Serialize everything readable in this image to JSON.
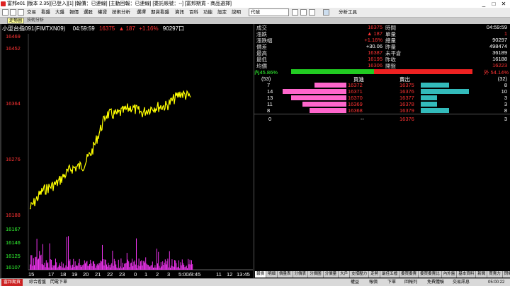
{
  "window": {
    "title": "富邦e01 [版本 2.35][已登入][1] [報價：已連線] [主動回報：已連線] [委託帳號：--] [富邦期貨 - 商品選擇]",
    "min": "_",
    "max": "□",
    "close": "✕"
  },
  "menu": {
    "items": [
      "交易",
      "看盤",
      "大盤",
      "報價",
      "選股",
      "權證",
      "技術分析",
      "選擇",
      "期貨看盤",
      "資訊",
      "百科",
      "功能",
      "設定",
      "說明",
      "視窗"
    ],
    "combo": "代號",
    "analysis": "分析工具"
  },
  "tabs": {
    "active": "走勢圖",
    "inactive": "技術分析"
  },
  "chart": {
    "product": "小型台指091(FIMTXN09)",
    "time": "04:59:59",
    "price": "16375",
    "arrow": "▲",
    "change": "187",
    "pct": "+1.16%",
    "volume": "90297口"
  },
  "chart_data": {
    "type": "line",
    "y_labels": [
      "16469",
      "16452",
      "16364",
      "16276",
      "16188"
    ],
    "vol_labels": [
      "16167",
      "16146",
      "16125",
      "16107"
    ],
    "x_labels": [
      "15",
      "17",
      "18",
      "19",
      "20",
      "21",
      "22",
      "23",
      "0",
      "1",
      "2",
      "3",
      "5:00/8:45",
      "11",
      "12",
      "13:45"
    ],
    "ylim": [
      16188,
      16469
    ]
  },
  "quote": {
    "left_labels": [
      "成交",
      "漲跌",
      "漲跌幅",
      "價差",
      "最高",
      "最低",
      "均價"
    ],
    "left_values": [
      "16375",
      "▲ 187",
      "+1.16%",
      "+30.06",
      "16387",
      "16195",
      "16306"
    ],
    "right_labels": [
      "時間",
      "單量",
      "總量",
      "昨量",
      "未平倉",
      "昨收",
      "開盤"
    ],
    "right_values": [
      "04:59:59",
      "1",
      "90297",
      "498474",
      "36189",
      "16188",
      "16223"
    ],
    "inner": "內45.86%",
    "outer": "外 54.14%",
    "bid_count": "(53)",
    "ask_count": "(32)",
    "bid_title": "買進",
    "ask_title": "賣出",
    "bids": [
      {
        "qty": "7",
        "price": "16372"
      },
      {
        "qty": "14",
        "price": "16371"
      },
      {
        "qty": "13",
        "price": "16370"
      },
      {
        "qty": "11",
        "price": "16369"
      },
      {
        "qty": "8",
        "price": "16368"
      }
    ],
    "asks": [
      {
        "price": "16375",
        "qty": "8"
      },
      {
        "price": "16376",
        "qty": "10"
      },
      {
        "price": "16377",
        "qty": "3"
      },
      {
        "price": "16378",
        "qty": "3"
      },
      {
        "price": "16379",
        "qty": "8"
      }
    ],
    "bid_fill": [
      0.45,
      0.9,
      0.78,
      0.62,
      0.52
    ],
    "ask_fill": [
      0.55,
      0.95,
      0.32,
      0.32,
      0.55
    ],
    "inner_fill": 0.4586,
    "footer": {
      "left": "0",
      "mid": "--",
      "price": "16376",
      "right": "3"
    }
  },
  "bottom_tabs": [
    "報價",
    "明細",
    "價量表",
    "分價表",
    "分價圖",
    "分價量",
    "大戶",
    "支撐壓力",
    "走勢",
    "最佳五檔",
    "委買委賣",
    "委買委賣比",
    "內外盤",
    "基本資料",
    "新聞",
    "買賣力",
    "閃電下單",
    "閃電委賣"
  ],
  "status": {
    "items": [
      "富邦期貨",
      "綜合看盤",
      "閃電下單"
    ],
    "right_items": [
      "權益",
      "報價",
      "下單",
      "回報列",
      "免費體驗",
      "交易訊息"
    ],
    "clock": "05:00:22"
  }
}
